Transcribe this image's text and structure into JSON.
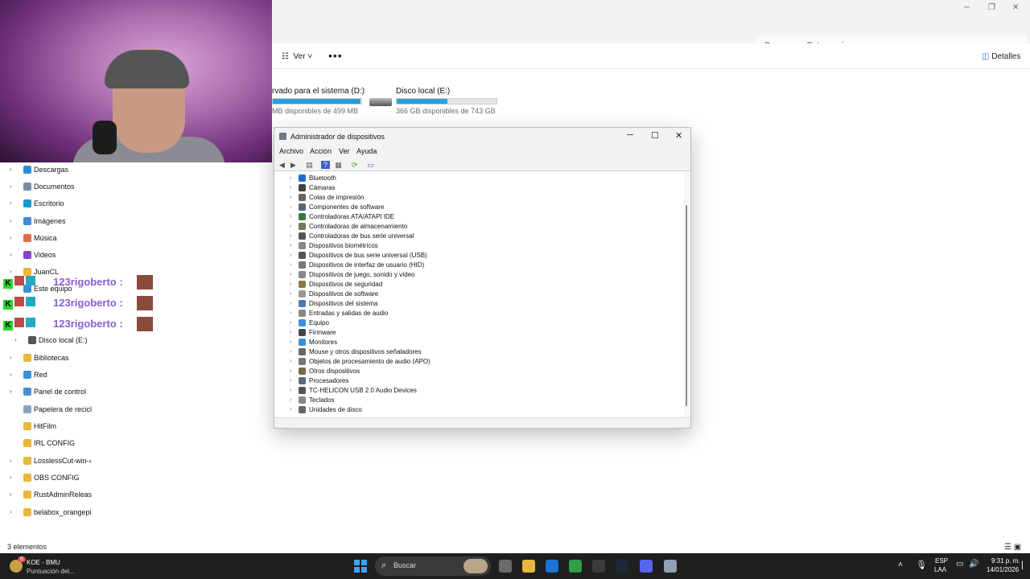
{
  "explorer": {
    "search_placeholder": "Buscar en Este equipo",
    "view_label": "Ver",
    "more_label": "•••",
    "details_label": "Detalles",
    "status_text": "3 elementos",
    "view_icons": "☰  ▣"
  },
  "drives": [
    {
      "name": "rvado para el sistema (D:)",
      "info": "MB disponibles de 499 MB",
      "fill_percent": 99
    },
    {
      "name": "Disco local (E:)",
      "info": "366 GB disponibles de 743 GB",
      "fill_percent": 51
    }
  ],
  "nav": {
    "items": [
      {
        "label": "Descargas",
        "color": "#2e8bd8"
      },
      {
        "label": "Documentos",
        "color": "#7a8ca3"
      },
      {
        "label": "Escritorio",
        "color": "#1c95c9"
      },
      {
        "label": "Imágenes",
        "color": "#3d8ed6"
      },
      {
        "label": "Música",
        "color": "#e06b4a"
      },
      {
        "label": "Videos",
        "color": "#8b46c8"
      },
      {
        "label": "JuanCL",
        "color": "#e7b73e"
      },
      {
        "label": "Este equipo",
        "color": "#3a8fd8"
      },
      {
        "label": "Disco local (E:)",
        "color": "#555555"
      },
      {
        "label": "Bibliotecas",
        "color": "#e7b73e"
      },
      {
        "label": "Red",
        "color": "#3a8fd8"
      },
      {
        "label": "Panel de control",
        "color": "#4b8dc8"
      },
      {
        "label": "Papelera de recicl",
        "color": "#8aa4c0"
      },
      {
        "label": "HitFilm",
        "color": "#e7b73e"
      },
      {
        "label": "IRL CONFIG",
        "color": "#e7b73e"
      },
      {
        "label": "LosslessCut-win-›",
        "color": "#e7b73e"
      },
      {
        "label": "OBS CONFIG",
        "color": "#e7b73e"
      },
      {
        "label": "RustAdminReleas",
        "color": "#e7b73e"
      },
      {
        "label": "belabox_orangepi",
        "color": "#e7b73e"
      }
    ]
  },
  "chat": {
    "lines": [
      {
        "user": "123rigoberto :"
      },
      {
        "user": "123rigoberto :"
      },
      {
        "user": "123rigoberto :"
      }
    ]
  },
  "device_manager": {
    "title": "Administrador de dispositivos",
    "menu": [
      "Archivo",
      "Acción",
      "Ver",
      "Ayuda"
    ],
    "categories": [
      {
        "label": "Bluetooth",
        "color": "#1a6fd1"
      },
      {
        "label": "Cámaras",
        "color": "#444444"
      },
      {
        "label": "Colas de impresión",
        "color": "#666666"
      },
      {
        "label": "Componentes de software",
        "color": "#556677"
      },
      {
        "label": "Controladoras ATA/ATAPI IDE",
        "color": "#3c7a3c"
      },
      {
        "label": "Controladoras de almacenamiento",
        "color": "#6b7c5a"
      },
      {
        "label": "Controladoras de bus serie universal",
        "color": "#555555"
      },
      {
        "label": "Dispositivos biométricos",
        "color": "#888888"
      },
      {
        "label": "Dispositivos de bus serie universal (USB)",
        "color": "#555555"
      },
      {
        "label": "Dispositivos de interfaz de usuario (HID)",
        "color": "#777777"
      },
      {
        "label": "Dispositivos de juego, sonido y vídeo",
        "color": "#888888"
      },
      {
        "label": "Dispositivos de seguridad",
        "color": "#8a7a40"
      },
      {
        "label": "Dispositivos de software",
        "color": "#999999"
      },
      {
        "label": "Dispositivos del sistema",
        "color": "#4a7ab0"
      },
      {
        "label": "Entradas y salidas de audio",
        "color": "#888888"
      },
      {
        "label": "Equipo",
        "color": "#3a8fd8"
      },
      {
        "label": "Firmware",
        "color": "#444444"
      },
      {
        "label": "Monitores",
        "color": "#3a8fd8"
      },
      {
        "label": "Mouse y otros dispositivos señaladores",
        "color": "#666666"
      },
      {
        "label": "Objetos de procesamiento de audio (APO)",
        "color": "#777777"
      },
      {
        "label": "Otros dispositivos",
        "color": "#7a6a4a"
      },
      {
        "label": "Procesadores",
        "color": "#5a6a7a"
      },
      {
        "label": "TC-HELICON USB 2.0 Audio Devices",
        "color": "#555555"
      },
      {
        "label": "Teclados",
        "color": "#888888"
      },
      {
        "label": "Unidades de disco",
        "color": "#666666"
      }
    ]
  },
  "taskbar": {
    "news_title": "KOE - BMU",
    "news_sub": "Puntuación del...",
    "news_badge": "6",
    "search_placeholder": "Buscar",
    "lang_line1": "ESP",
    "lang_line2": "LAA",
    "time": "9:31 p. m.",
    "date": "14/01/2026",
    "apps": [
      {
        "name": "task-view",
        "color": "#6a6a6a"
      },
      {
        "name": "file-explorer",
        "color": "#e7b73e"
      },
      {
        "name": "outlook",
        "color": "#1a73d9"
      },
      {
        "name": "chrome",
        "color": "#2f9e44"
      },
      {
        "name": "obs",
        "color": "#3b3b3b"
      },
      {
        "name": "steam",
        "color": "#1b2838"
      },
      {
        "name": "discord",
        "color": "#5865f2"
      },
      {
        "name": "device-manager",
        "color": "#8fa0b0"
      }
    ]
  }
}
